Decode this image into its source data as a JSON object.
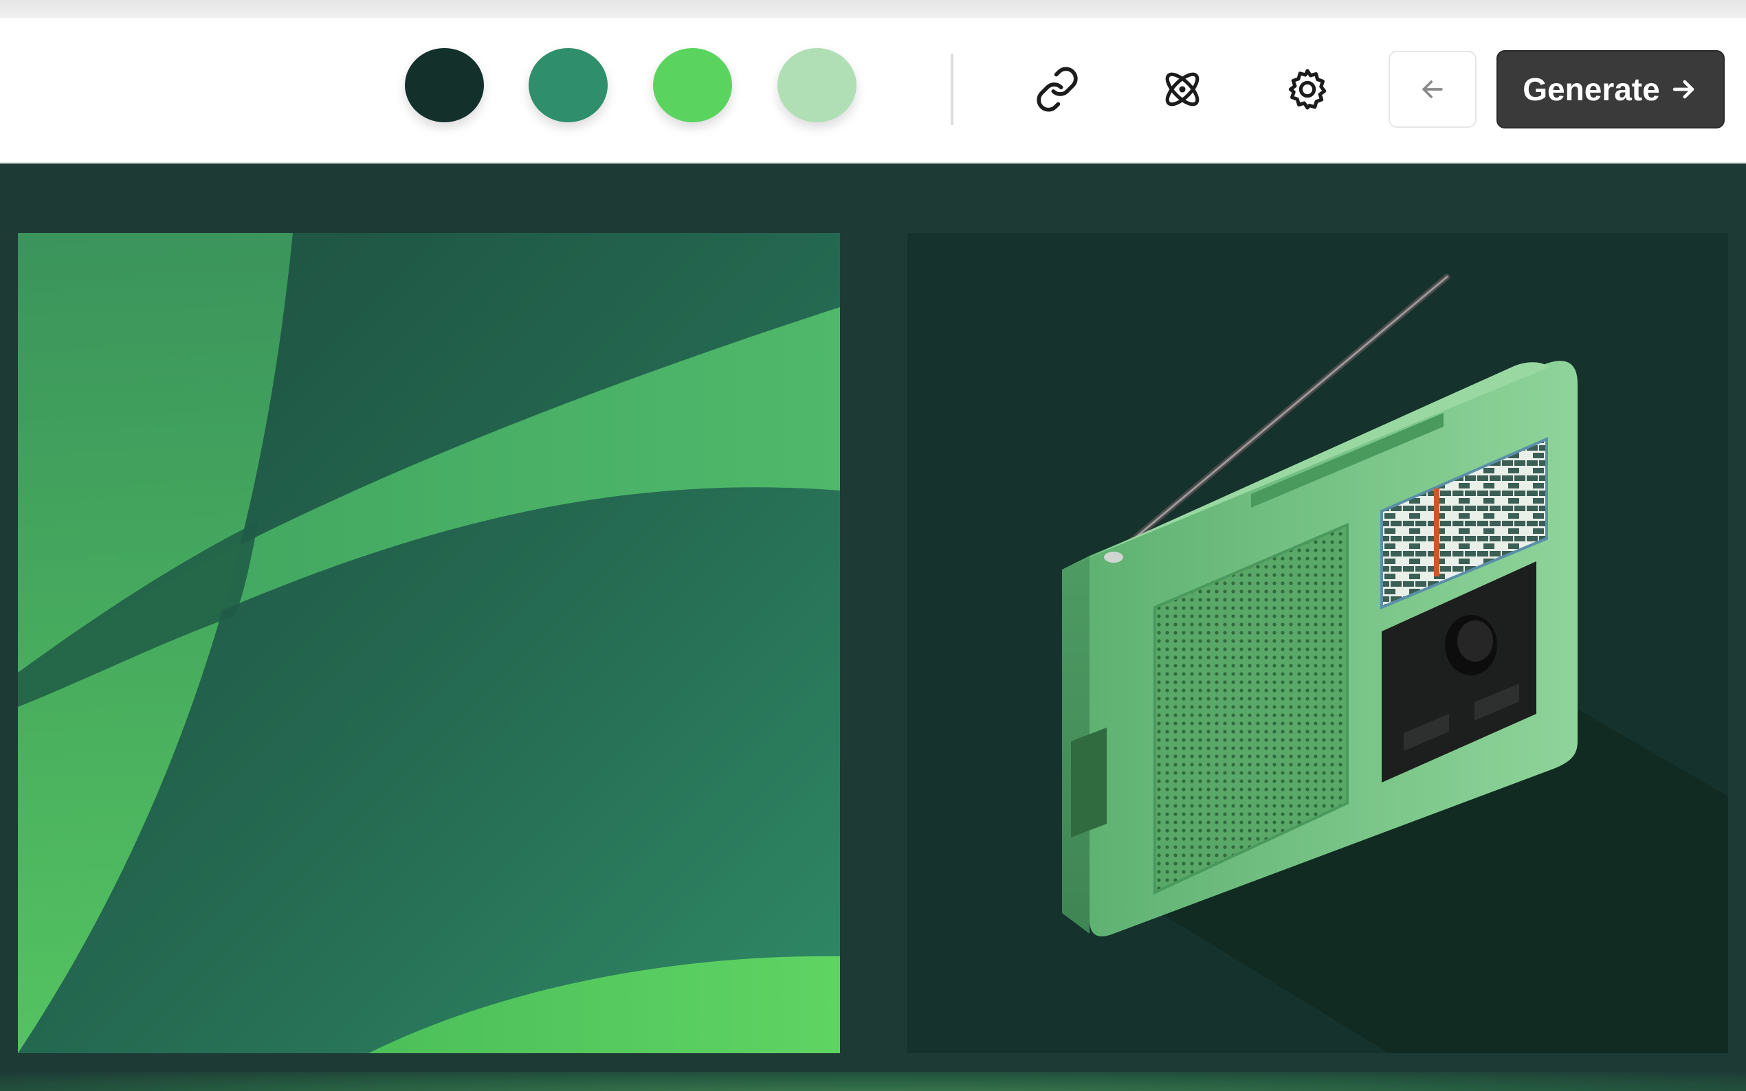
{
  "toolbar": {
    "swatches": [
      {
        "name": "swatch-dark-green",
        "color": "#13302b"
      },
      {
        "name": "swatch-teal-green",
        "color": "#2f8e6b"
      },
      {
        "name": "swatch-bright-green",
        "color": "#5ad45f"
      },
      {
        "name": "swatch-light-green",
        "color": "#b1dfb5"
      }
    ],
    "icons": [
      "link-icon",
      "atom-icon",
      "gear-icon",
      "arrow-left-icon",
      "arrow-right-icon"
    ],
    "generate_label": "Generate"
  },
  "canvas": {
    "background": "#1d3a35",
    "previews": [
      {
        "name": "abstract-curves-preview",
        "palette": [
          "#1f5a48",
          "#2f8e6b",
          "#5ad45f"
        ]
      },
      {
        "name": "radio-illustration-preview",
        "palette": [
          "#15322c",
          "#6fc27f",
          "#0f1614"
        ]
      }
    ]
  }
}
